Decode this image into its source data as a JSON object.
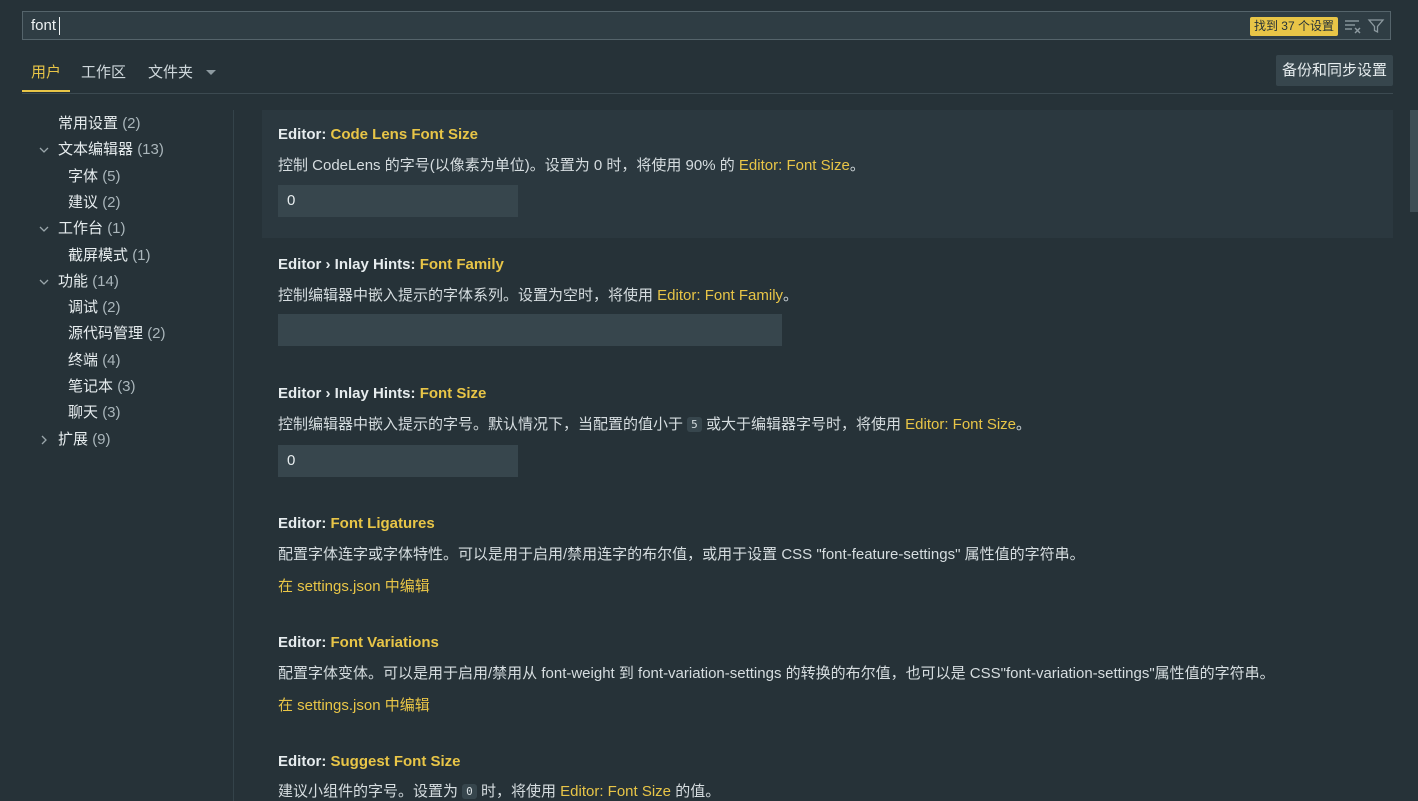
{
  "search": {
    "value": "font",
    "result_badge": "找到 37 个设置"
  },
  "tabs": [
    {
      "label": "用户"
    },
    {
      "label": "工作区"
    },
    {
      "label": "文件夹"
    }
  ],
  "sync_button": "备份和同步设置",
  "toc": [
    {
      "label": "常用设置",
      "count": "(2)"
    },
    {
      "label": "文本编辑器",
      "count": "(13)"
    },
    {
      "label": "字体",
      "count": "(5)"
    },
    {
      "label": "建议",
      "count": "(2)"
    },
    {
      "label": "工作台",
      "count": "(1)"
    },
    {
      "label": "截屏模式",
      "count": "(1)"
    },
    {
      "label": "功能",
      "count": "(14)"
    },
    {
      "label": "调试",
      "count": "(2)"
    },
    {
      "label": "源代码管理",
      "count": "(2)"
    },
    {
      "label": "终端",
      "count": "(4)"
    },
    {
      "label": "笔记本",
      "count": "(3)"
    },
    {
      "label": "聊天",
      "count": "(3)"
    },
    {
      "label": "扩展",
      "count": "(9)"
    }
  ],
  "settings": [
    {
      "prefix": "Editor: ",
      "name": "Code Lens Font Size",
      "desc_before": "控制 CodeLens 的字号(以像素为单位)。设置为 0 时，将使用 90% 的 ",
      "desc_link": "Editor: Font Size",
      "desc_after": "。",
      "value": "0"
    },
    {
      "prefix": "Editor › Inlay Hints: ",
      "name": "Font Family",
      "desc_before": "控制编辑器中嵌入提示的字体系列。设置为空时，将使用 ",
      "desc_link": "Editor: Font Family",
      "desc_after": "。",
      "value": ""
    },
    {
      "prefix": "Editor › Inlay Hints: ",
      "name": "Font Size",
      "desc_before": "控制编辑器中嵌入提示的字号。默认情况下，当配置的值小于 ",
      "desc_code": "5",
      "desc_middle": " 或大于编辑器字号时，将使用 ",
      "desc_link": "Editor: Font Size",
      "desc_after": "。",
      "value": "0"
    },
    {
      "prefix": "Editor: ",
      "name": "Font Ligatures",
      "desc": "配置字体连字或字体特性。可以是用于启用/禁用连字的布尔值，或用于设置 CSS \"font-feature-settings\" 属性值的字符串。",
      "edit_link": "在 settings.json 中编辑"
    },
    {
      "prefix": "Editor: ",
      "name": "Font Variations",
      "desc": "配置字体变体。可以是用于启用/禁用从 font-weight 到 font-variation-settings 的转换的布尔值，也可以是 CSS\"font-variation-settings\"属性值的字符串。",
      "edit_link": "在 settings.json 中编辑"
    },
    {
      "prefix": "Editor: ",
      "name": "Suggest Font Size",
      "desc_before": "建议小组件的字号。设置为 ",
      "desc_code": "0",
      "desc_middle": " 时，将使用 ",
      "desc_link": "Editor: Font Size",
      "desc_after": " 的值。"
    }
  ],
  "colors": {
    "accent": "#e8c547",
    "background": "#263238"
  },
  "icons": [
    "clear-filter-icon",
    "filter-icon",
    "chevron-down-icon",
    "chevron-right-icon"
  ]
}
